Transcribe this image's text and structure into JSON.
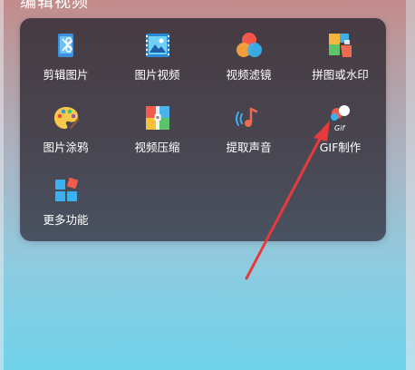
{
  "header": {
    "title": "编辑视频"
  },
  "panel": {
    "items": [
      {
        "label": "剪辑图片"
      },
      {
        "label": "图片视频"
      },
      {
        "label": "视频滤镜"
      },
      {
        "label": "拼图或水印"
      },
      {
        "label": "图片涂鸦"
      },
      {
        "label": "视频压缩"
      },
      {
        "label": "提取声音"
      },
      {
        "label": "GIF制作",
        "icon_text": "Gif"
      },
      {
        "label": "更多功能"
      }
    ]
  },
  "colors": {
    "annotation_arrow": "#e8393d",
    "panel_bg": "#3a323a"
  }
}
